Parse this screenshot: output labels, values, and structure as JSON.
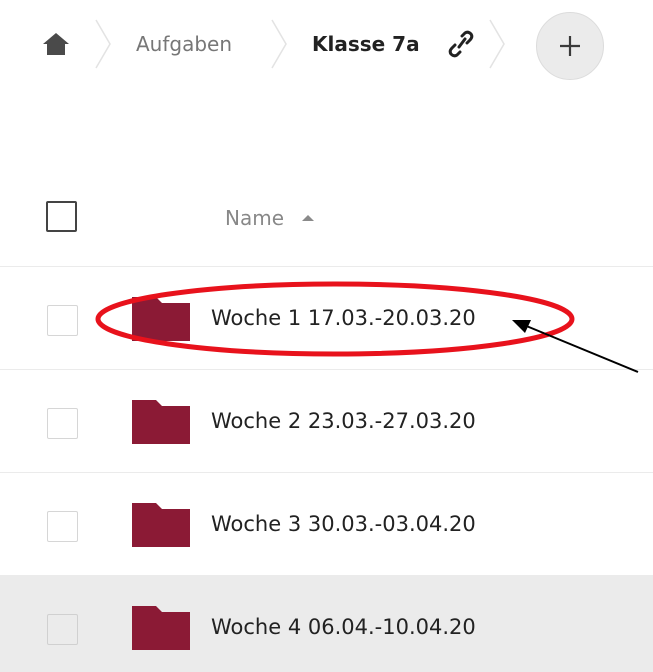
{
  "breadcrumb": {
    "home_icon": "home-icon",
    "items": [
      {
        "label": "Aufgaben"
      },
      {
        "label": "Klasse 7a"
      }
    ],
    "share_icon": "link-icon",
    "add_label": "+"
  },
  "list": {
    "header": {
      "name_label": "Name",
      "sort": "ascending"
    },
    "rows": [
      {
        "name": "Woche 1 17.03.-20.03.20"
      },
      {
        "name": "Woche 2 23.03.-27.03.20"
      },
      {
        "name": "Woche 3 30.03.-03.04.20"
      },
      {
        "name": "Woche 4 06.04.-10.04.20"
      }
    ]
  },
  "colors": {
    "folder": "#8b1a35",
    "highlight_ellipse": "#e8121c",
    "arrow": "#000000",
    "hover_row": "#ebebeb"
  }
}
